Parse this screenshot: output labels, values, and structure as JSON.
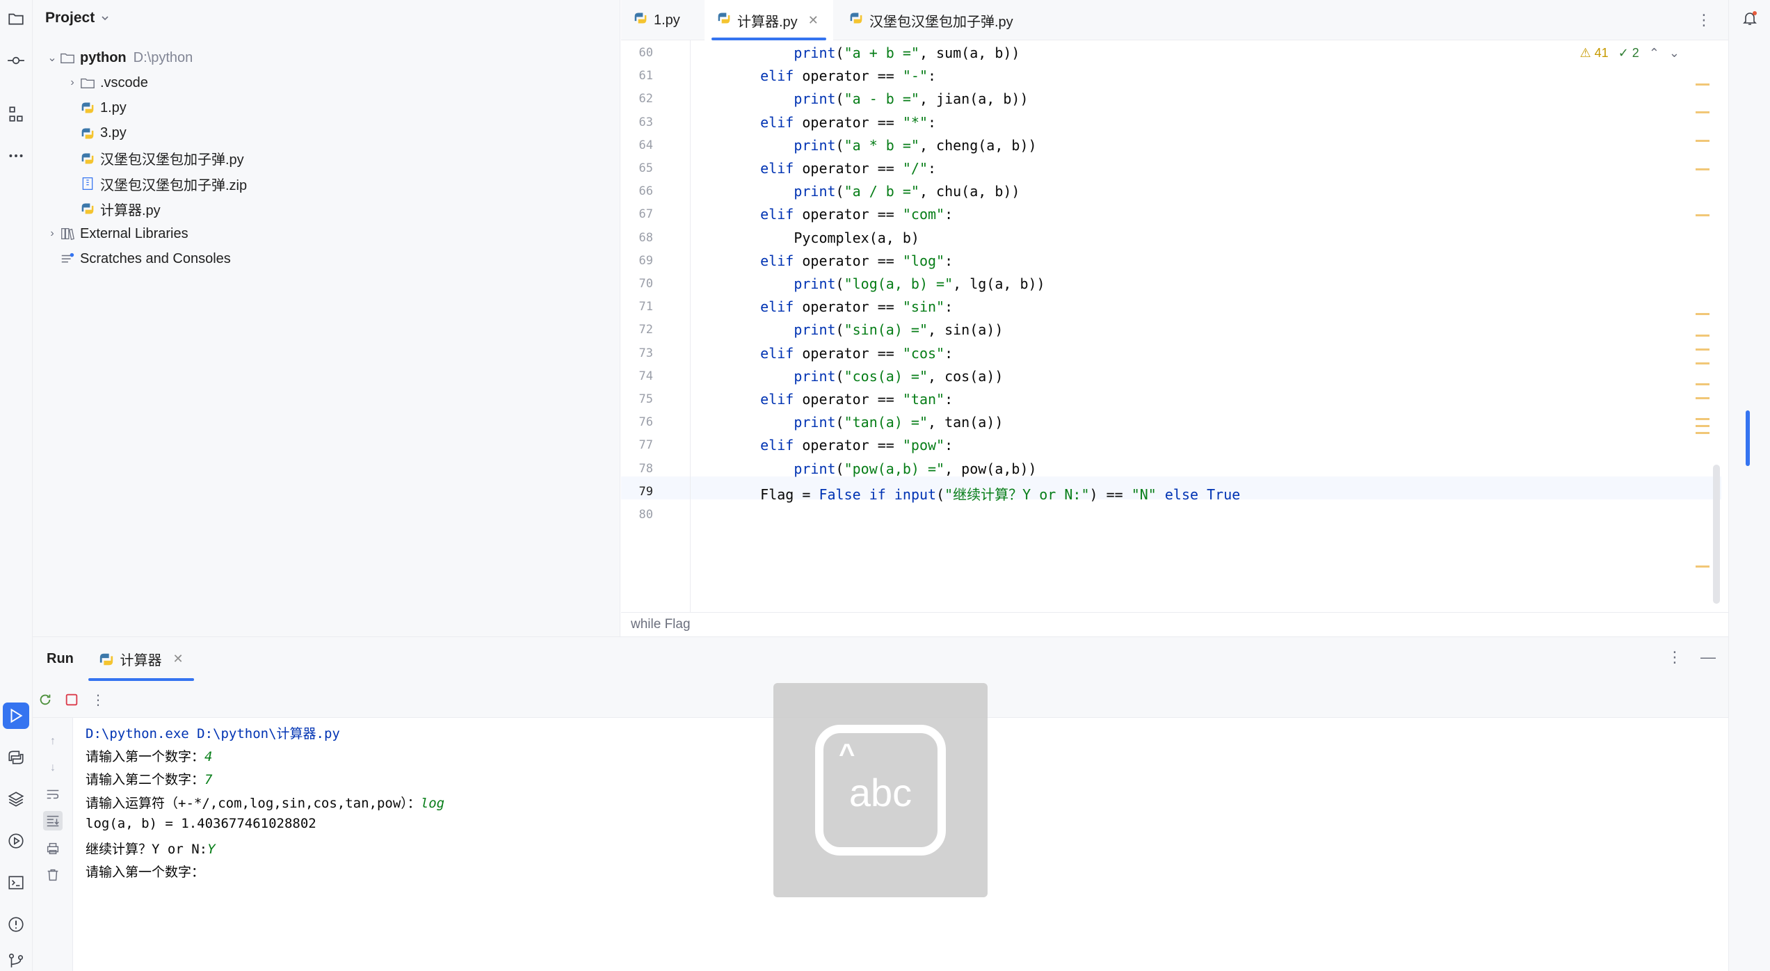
{
  "project": {
    "header": "Project",
    "tree": [
      {
        "label": "python",
        "path": "D:\\python",
        "level": 0,
        "type": "folder",
        "expanded": true
      },
      {
        "label": ".vscode",
        "level": 1,
        "type": "folder",
        "expanded": false
      },
      {
        "label": "1.py",
        "level": 1,
        "type": "python"
      },
      {
        "label": "3.py",
        "level": 1,
        "type": "python"
      },
      {
        "label": "汉堡包汉堡包加子弹.py",
        "level": 1,
        "type": "python"
      },
      {
        "label": "汉堡包汉堡包加子弹.zip",
        "level": 1,
        "type": "zip"
      },
      {
        "label": "计算器.py",
        "level": 1,
        "type": "python"
      },
      {
        "label": "External Libraries",
        "level": 0,
        "type": "library",
        "expanded": false
      },
      {
        "label": "Scratches and Consoles",
        "level": 0,
        "type": "scratch"
      }
    ]
  },
  "tabs": [
    {
      "label": "1.py",
      "active": false
    },
    {
      "label": "计算器.py",
      "active": true
    },
    {
      "label": "汉堡包汉堡包加子弹.py",
      "active": false
    }
  ],
  "editor": {
    "inspections": {
      "warnings": "41",
      "weak": "2"
    },
    "lines": [
      {
        "n": "60",
        "tokens": [
          [
            "p",
            "        "
          ],
          [
            "kw",
            "print"
          ],
          [
            "p",
            "("
          ],
          [
            "str",
            "\"a + b =\""
          ],
          [
            "p",
            ", sum(a, b))"
          ]
        ]
      },
      {
        "n": "61",
        "tokens": [
          [
            "p",
            "    "
          ],
          [
            "kw",
            "elif"
          ],
          [
            "p",
            " operator == "
          ],
          [
            "str",
            "\"-\""
          ],
          [
            "p",
            ":"
          ]
        ]
      },
      {
        "n": "62",
        "tokens": [
          [
            "p",
            "        "
          ],
          [
            "kw",
            "print"
          ],
          [
            "p",
            "("
          ],
          [
            "str",
            "\"a - b =\""
          ],
          [
            "p",
            ", jian(a, b))"
          ]
        ]
      },
      {
        "n": "63",
        "tokens": [
          [
            "p",
            "    "
          ],
          [
            "kw",
            "elif"
          ],
          [
            "p",
            " operator == "
          ],
          [
            "str",
            "\"*\""
          ],
          [
            "p",
            ":"
          ]
        ]
      },
      {
        "n": "64",
        "tokens": [
          [
            "p",
            "        "
          ],
          [
            "kw",
            "print"
          ],
          [
            "p",
            "("
          ],
          [
            "str",
            "\"a * b =\""
          ],
          [
            "p",
            ", cheng(a, b))"
          ]
        ]
      },
      {
        "n": "65",
        "tokens": [
          [
            "p",
            "    "
          ],
          [
            "kw",
            "elif"
          ],
          [
            "p",
            " operator == "
          ],
          [
            "str",
            "\"/\""
          ],
          [
            "p",
            ":"
          ]
        ]
      },
      {
        "n": "66",
        "tokens": [
          [
            "p",
            "        "
          ],
          [
            "kw",
            "print"
          ],
          [
            "p",
            "("
          ],
          [
            "str",
            "\"a / b =\""
          ],
          [
            "p",
            ", chu(a, b))"
          ]
        ]
      },
      {
        "n": "67",
        "tokens": [
          [
            "p",
            "    "
          ],
          [
            "kw",
            "elif"
          ],
          [
            "p",
            " operator == "
          ],
          [
            "str",
            "\"com\""
          ],
          [
            "p",
            ":"
          ]
        ]
      },
      {
        "n": "68",
        "tokens": [
          [
            "p",
            "        Pycomplex(a, b)"
          ]
        ]
      },
      {
        "n": "69",
        "tokens": [
          [
            "p",
            "    "
          ],
          [
            "kw",
            "elif"
          ],
          [
            "p",
            " operator == "
          ],
          [
            "str",
            "\"log\""
          ],
          [
            "p",
            ":"
          ]
        ]
      },
      {
        "n": "70",
        "tokens": [
          [
            "p",
            "        "
          ],
          [
            "kw",
            "print"
          ],
          [
            "p",
            "("
          ],
          [
            "str",
            "\"log(a, b) =\""
          ],
          [
            "p",
            ", lg(a, b))"
          ]
        ]
      },
      {
        "n": "71",
        "tokens": [
          [
            "p",
            "    "
          ],
          [
            "kw",
            "elif"
          ],
          [
            "p",
            " operator == "
          ],
          [
            "str",
            "\"sin\""
          ],
          [
            "p",
            ":"
          ]
        ]
      },
      {
        "n": "72",
        "tokens": [
          [
            "p",
            "        "
          ],
          [
            "kw",
            "print"
          ],
          [
            "p",
            "("
          ],
          [
            "str",
            "\"sin(a) =\""
          ],
          [
            "p",
            ", sin(a))"
          ]
        ]
      },
      {
        "n": "73",
        "tokens": [
          [
            "p",
            "    "
          ],
          [
            "kw",
            "elif"
          ],
          [
            "p",
            " operator == "
          ],
          [
            "str",
            "\"cos\""
          ],
          [
            "p",
            ":"
          ]
        ]
      },
      {
        "n": "74",
        "tokens": [
          [
            "p",
            "        "
          ],
          [
            "kw",
            "print"
          ],
          [
            "p",
            "("
          ],
          [
            "str",
            "\"cos(a) =\""
          ],
          [
            "p",
            ", cos(a))"
          ]
        ]
      },
      {
        "n": "75",
        "tokens": [
          [
            "p",
            "    "
          ],
          [
            "kw",
            "elif"
          ],
          [
            "p",
            " operator == "
          ],
          [
            "str",
            "\"tan\""
          ],
          [
            "p",
            ":"
          ]
        ]
      },
      {
        "n": "76",
        "tokens": [
          [
            "p",
            "        "
          ],
          [
            "kw",
            "print"
          ],
          [
            "p",
            "("
          ],
          [
            "str",
            "\"tan(a) =\""
          ],
          [
            "p",
            ", tan(a))"
          ]
        ]
      },
      {
        "n": "77",
        "tokens": [
          [
            "p",
            "    "
          ],
          [
            "kw",
            "elif"
          ],
          [
            "p",
            " operator == "
          ],
          [
            "str",
            "\"pow\""
          ],
          [
            "p",
            ":"
          ]
        ]
      },
      {
        "n": "78",
        "tokens": [
          [
            "p",
            "        "
          ],
          [
            "kw",
            "print"
          ],
          [
            "p",
            "("
          ],
          [
            "str",
            "\"pow(a,b) =\""
          ],
          [
            "p",
            ", pow(a,b))"
          ]
        ]
      },
      {
        "n": "79",
        "tokens": [
          [
            "p",
            "    Flag = "
          ],
          [
            "kw",
            "False"
          ],
          [
            "p",
            " "
          ],
          [
            "kw",
            "if"
          ],
          [
            "p",
            " "
          ],
          [
            "kw",
            "input"
          ],
          [
            "p",
            "("
          ],
          [
            "str",
            "\"继续计算？Y or N:\""
          ],
          [
            "p",
            ") == "
          ],
          [
            "str",
            "\"N\""
          ],
          [
            "p",
            " "
          ],
          [
            "kw",
            "else"
          ],
          [
            "p",
            " "
          ],
          [
            "kw",
            "True"
          ]
        ]
      },
      {
        "n": "80",
        "tokens": [
          [
            "p",
            ""
          ]
        ]
      }
    ],
    "breadcrumb": "while Flag"
  },
  "run": {
    "title": "Run",
    "tab_label": "计算器",
    "console": [
      {
        "type": "cmd",
        "text": "D:\\python.exe D:\\python\\计算器.py"
      },
      {
        "type": "io",
        "prompt": "请输入第一个数字：",
        "input": "4"
      },
      {
        "type": "io",
        "prompt": "请输入第二个数字：",
        "input": "7"
      },
      {
        "type": "io",
        "prompt": "请输入运算符（+-*/,com,log,sin,cos,tan,pow）：",
        "input": "log"
      },
      {
        "type": "io",
        "prompt": "log(a, b) = 1.403677461028802",
        "input": ""
      },
      {
        "type": "io",
        "prompt": "继续计算？Y or N:",
        "input": "Y"
      },
      {
        "type": "io",
        "prompt": "请输入第一个数字：",
        "input": ""
      }
    ]
  },
  "ime": {
    "label": "abc"
  }
}
